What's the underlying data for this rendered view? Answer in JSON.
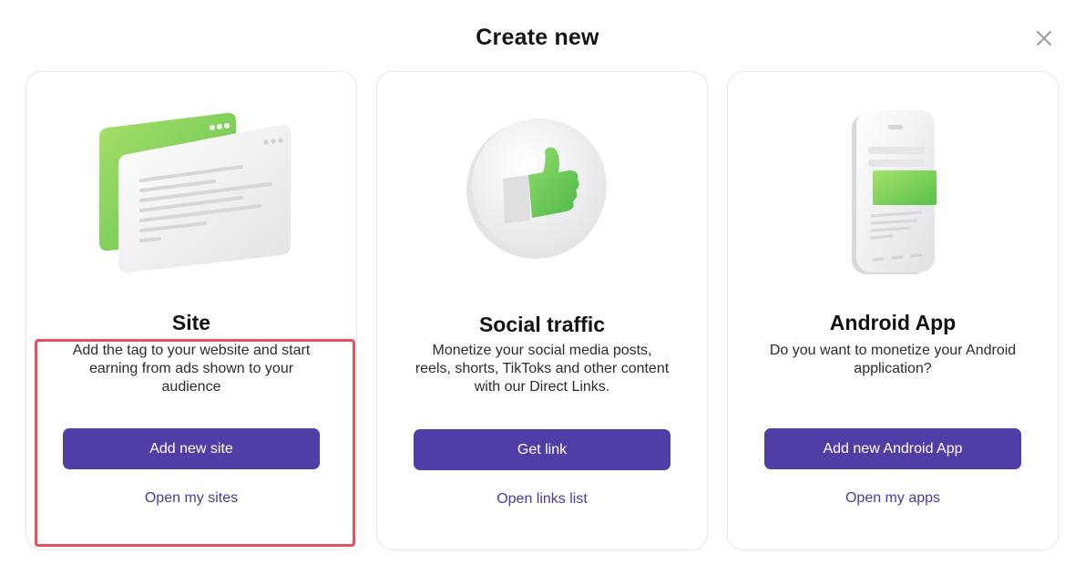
{
  "dialog": {
    "title": "Create new"
  },
  "icons": {
    "close": "close-icon"
  },
  "colors": {
    "primary": "#513da6",
    "link": "#4a3a9e",
    "highlight": "#ea4f5e",
    "accent_green": "#6ccf5a"
  },
  "cards": [
    {
      "title": "Site",
      "description": "Add the tag to your website and start earning from ads shown to your audience",
      "button": "Add new site",
      "link": "Open my sites"
    },
    {
      "title": "Social traffic",
      "description": "Monetize your social media posts, reels, shorts, TikToks and other content with our Direct Links.",
      "button": "Get link",
      "link": "Open links list"
    },
    {
      "title": "Android App",
      "description": "Do you want to monetize your Android application?",
      "button": "Add new Android App",
      "link": "Open my apps"
    }
  ]
}
